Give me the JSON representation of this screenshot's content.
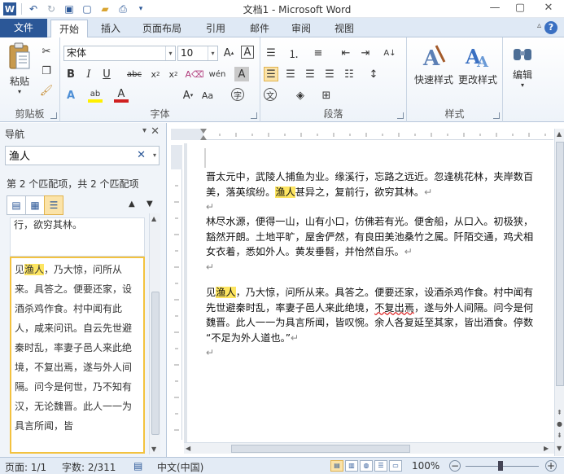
{
  "window": {
    "title": "文档1 - Microsoft Word"
  },
  "ribbon": {
    "file_tab": "文件",
    "tabs": [
      "开始",
      "插入",
      "页面布局",
      "引用",
      "邮件",
      "审阅",
      "视图"
    ],
    "active_tab": "开始",
    "clipboard": {
      "paste": "粘贴",
      "label": "剪贴板"
    },
    "font": {
      "family": "宋体",
      "size": "10",
      "label": "字体"
    },
    "paragraph": {
      "label": "段落"
    },
    "styles": {
      "quick_styles": "快速样式",
      "change_styles": "更改样式",
      "label": "样式"
    },
    "editing": {
      "label": "编辑"
    }
  },
  "nav_pane": {
    "title": "导航",
    "search_value": "渔人",
    "match_count": "第 2 个匹配项，共 2 个匹配项",
    "results": [
      {
        "text": "行，欲穷其林。"
      },
      {
        "before": "见",
        "match": "渔人",
        "after": "，乃大惊，问所从来。具答之。便要还家，设酒杀鸡作食。村中闻有此人，咸来问讯。自云先世避秦时乱，率妻子邑人来此绝境，不复出焉，遂与外人间隔。问今是何世，乃不知有汉，无论魏晋。此人一一为具言所闻，皆"
      }
    ]
  },
  "document": {
    "paragraphs": [
      {
        "lines": [
          {
            "text": "晋太元中，武陵人捕鱼为业。缘溪行，忘路之远近。忽逢桃花林，夹岸数百"
          },
          {
            "before": "美，落英缤纷。",
            "match": "渔人",
            "after": "甚异之，复前行，欲穷其林。"
          }
        ]
      },
      {
        "lines": [
          {
            "text": "林尽水源，便得一山，山有小口，仿佛若有光。便舍船，从口入。初极狭，"
          },
          {
            "text": "豁然开朗。土地平旷，屋舍俨然，有良田美池桑竹之属。阡陌交通，鸡犬相"
          },
          {
            "text": "女衣着，悉如外人。黄发垂髫，并怡然自乐。"
          }
        ]
      },
      {
        "lines": [
          {
            "before": "见",
            "match": "渔人",
            "after": "，乃大惊，问所从来。具答之。便要还家，设酒杀鸡作食。村中闻有"
          },
          {
            "before": "先世避秦时乱，率妻子邑人来此绝境，",
            "squig": "不复出焉",
            "after": "，遂与外人间隔。问今是何"
          },
          {
            "text": "魏晋。此人一一为具言所闻，皆叹惋。余人各复延至其家，皆出酒食。停数"
          },
          {
            "text": "“不足为外人道也。”"
          }
        ]
      }
    ]
  },
  "status": {
    "page": "页面: 1/1",
    "words": "字数: 2/311",
    "language": "中文(中国)",
    "zoom": "100%"
  },
  "colors": {
    "accent": "#2b5797",
    "highlight": "#fde561",
    "selected_result_border": "#f3c23f"
  }
}
